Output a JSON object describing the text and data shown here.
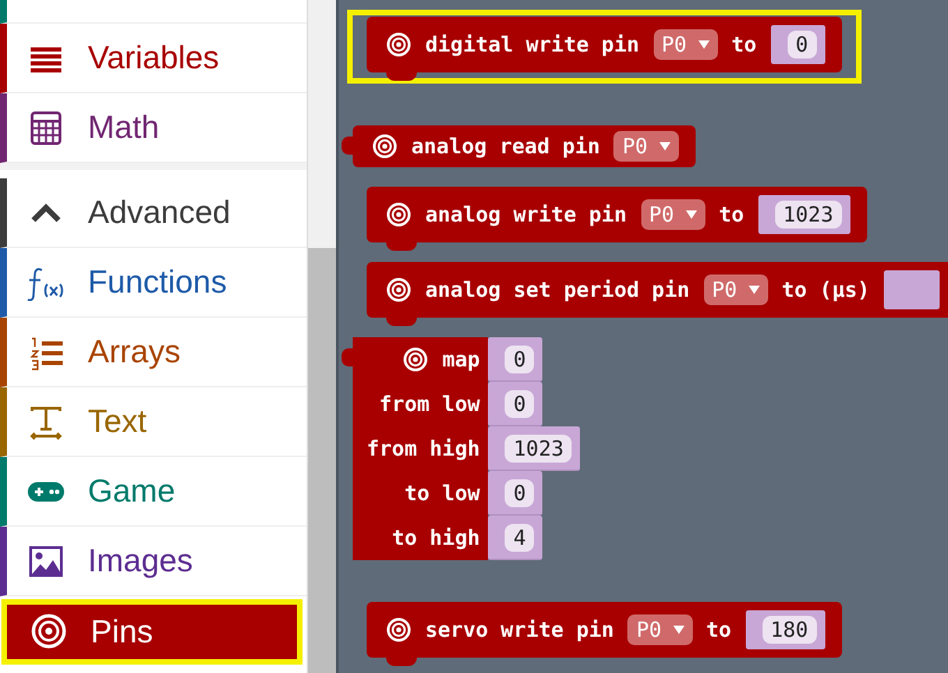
{
  "sidebar": {
    "items": [
      {
        "color": "#00796b",
        "selected": false
      },
      {
        "label": "Variables",
        "color": "#a80000",
        "selected": false
      },
      {
        "label": "Math",
        "color": "#712672",
        "selected": false
      },
      {
        "label": "Advanced",
        "color": "#3c3c3c",
        "selected": false,
        "expanded": true,
        "kind": "toggle"
      },
      {
        "label": "Functions",
        "color": "#1e5aa8",
        "selected": false
      },
      {
        "label": "Arrays",
        "color": "#a94400",
        "selected": false
      },
      {
        "label": "Text",
        "color": "#996600",
        "selected": false
      },
      {
        "label": "Game",
        "color": "#007a6b",
        "selected": false
      },
      {
        "label": "Images",
        "color": "#5c2d91",
        "selected": false
      },
      {
        "label": "Pins",
        "color": "#a80000",
        "selected": true
      }
    ]
  },
  "blocks": [
    {
      "kind": "statement",
      "highlighted": true,
      "parts": [
        {
          "kind": "label",
          "text": "digital write pin"
        },
        {
          "kind": "dropdown",
          "text": "P0"
        },
        {
          "kind": "label",
          "text": "to"
        },
        {
          "kind": "number",
          "text": "0"
        }
      ]
    },
    {
      "kind": "reporter",
      "highlighted": false,
      "parts": [
        {
          "kind": "label",
          "text": "analog read pin"
        },
        {
          "kind": "dropdown",
          "text": "P0"
        }
      ]
    },
    {
      "kind": "statement",
      "highlighted": false,
      "parts": [
        {
          "kind": "label",
          "text": "analog write pin"
        },
        {
          "kind": "dropdown",
          "text": "P0"
        },
        {
          "kind": "label",
          "text": "to"
        },
        {
          "kind": "number",
          "text": "1023"
        }
      ]
    },
    {
      "kind": "statement",
      "highlighted": false,
      "parts": [
        {
          "kind": "label",
          "text": "analog set period pin"
        },
        {
          "kind": "dropdown",
          "text": "P0"
        },
        {
          "kind": "label",
          "text": "to (µs)"
        },
        {
          "kind": "socket"
        }
      ]
    },
    {
      "kind": "map",
      "highlighted": false,
      "rows": [
        {
          "label": "map",
          "value": "0"
        },
        {
          "label": "from low",
          "value": "0"
        },
        {
          "label": "from high",
          "value": "1023"
        },
        {
          "label": "to low",
          "value": "0"
        },
        {
          "label": "to high",
          "value": "4"
        }
      ]
    },
    {
      "kind": "statement",
      "highlighted": false,
      "parts": [
        {
          "kind": "label",
          "text": "servo write pin"
        },
        {
          "kind": "dropdown",
          "text": "P0"
        },
        {
          "kind": "label",
          "text": "to"
        },
        {
          "kind": "number",
          "text": "180"
        }
      ]
    }
  ]
}
